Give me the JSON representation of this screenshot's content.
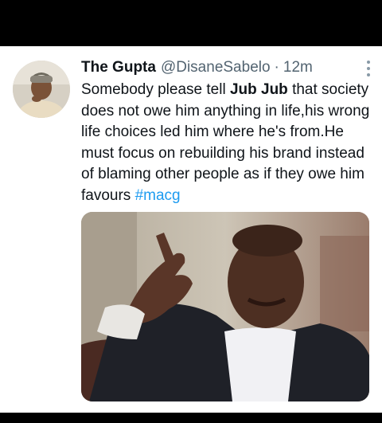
{
  "tweet": {
    "author_name": "The Gupta",
    "handle": "@DisaneSabelo",
    "separator": "·",
    "time": "12m",
    "text_part1": "Somebody please tell ",
    "text_bold": "Jub Jub",
    "text_part2": " that society does not owe him anything in life,his wrong life choices led him where he's from.He must focus on rebuilding his brand instead of blaming other people as if they owe him favours ",
    "hashtag": "#macg"
  },
  "colors": {
    "name": "#0f1419",
    "secondary": "#536471",
    "link": "#1d9bf0",
    "background": "#ffffff"
  },
  "icons": {
    "more": "more-vertical-icon"
  }
}
